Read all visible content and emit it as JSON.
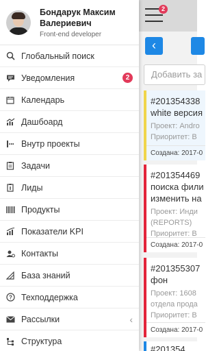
{
  "profile": {
    "name": "Бондарук Максим Валериевич",
    "role": "Front-end developer"
  },
  "topbar": {
    "badge": "2"
  },
  "search_placeholder": "Добавить за",
  "menu": [
    {
      "label": "Глобальный поиск",
      "icon": "search-icon"
    },
    {
      "label": "Уведомления",
      "icon": "chat-bubble-icon",
      "badge": "2"
    },
    {
      "label": "Календарь",
      "icon": "calendar-icon"
    },
    {
      "label": "Дашбоард",
      "icon": "chart-icon"
    },
    {
      "label": "Внутр проекты",
      "icon": "projects-icon"
    },
    {
      "label": "Задачи",
      "icon": "clipboard-icon"
    },
    {
      "label": "Лиды",
      "icon": "leads-icon"
    },
    {
      "label": "Продукты",
      "icon": "barcode-icon"
    },
    {
      "label": "Показатели KPI",
      "icon": "kpi-icon"
    },
    {
      "label": "Контакты",
      "icon": "contacts-icon"
    },
    {
      "label": "База знаний",
      "icon": "knowledge-icon"
    },
    {
      "label": "Техподдержка",
      "icon": "help-icon"
    },
    {
      "label": "Рассылки",
      "icon": "mail-icon",
      "chevron": "‹"
    },
    {
      "label": "Структура",
      "icon": "structure-icon"
    }
  ],
  "cards": [
    {
      "number": "#201354338",
      "title": "white версия",
      "project": "Проект: Andro",
      "priority": "Приоритет: В",
      "created": "Создана: 2017-0"
    },
    {
      "number": "#201354469",
      "title": "поиска фили",
      "title2": "изменить на",
      "project": "Проект: Инди",
      "project2": "(REPORTS)",
      "priority": "Приоритет: В",
      "created": "Создана: 2017-0"
    },
    {
      "number": "#201355307",
      "title": "фон",
      "project": "Проект: 1608",
      "project2": "отдела прода",
      "priority": "Приоритет: В",
      "created": "Создана: 2017-0"
    },
    {
      "number": "#201354"
    }
  ],
  "colors": {
    "accent": "#1e88e5",
    "badge": "#e23a5a",
    "urgent": "#e3243b",
    "warning": "#f0d54a"
  }
}
